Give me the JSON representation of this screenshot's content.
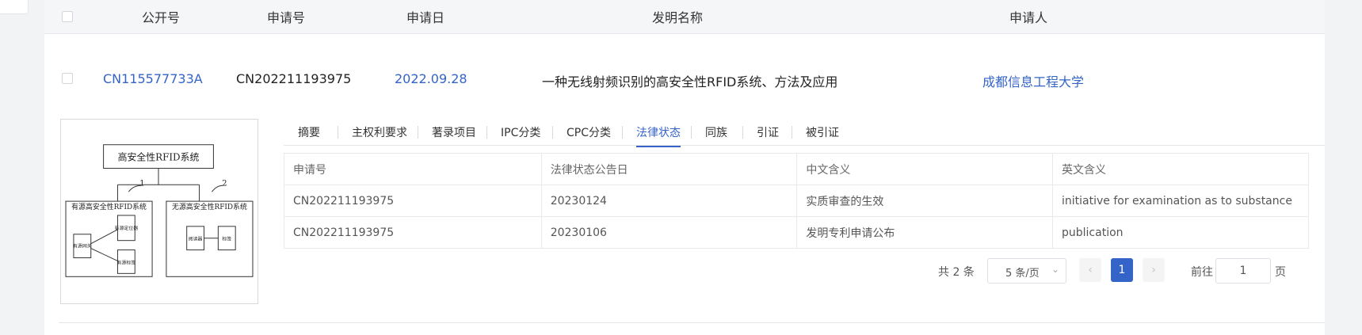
{
  "columns": [
    "公开号",
    "申请号",
    "申请日",
    "发明名称",
    "申请人"
  ],
  "record": {
    "pub_no": "CN115577733A",
    "app_no": "CN202211193975",
    "app_date": "2022.09.28",
    "title": "一种无线射频识别的高安全性RFID系统、方法及应用",
    "applicant": "成都信息工程大学"
  },
  "figure": {
    "top_box": "高安全性RFID系统",
    "left_group": "有源高安全性RFID系统",
    "right_group": "无源高安全性RFID系统",
    "label1": "1",
    "label2": "2",
    "left_node_a": "有源定位器",
    "left_node_b": "有源标签",
    "left_node_c": "有源网关",
    "right_node_a": "阅读器",
    "right_node_b": "标签"
  },
  "tabs": [
    "摘要",
    "主权利要求",
    "著录项目",
    "IPC分类",
    "CPC分类",
    "法律状态",
    "同族",
    "引证",
    "被引证"
  ],
  "active_tab": "法律状态",
  "legal_table": {
    "headers": [
      "申请号",
      "法律状态公告日",
      "中文含义",
      "英文含义"
    ],
    "rows": [
      [
        "CN202211193975",
        "20230124",
        "实质审查的生效",
        "initiative for examination as to substance"
      ],
      [
        "CN202211193975",
        "20230106",
        "发明专利申请公布",
        "publication"
      ]
    ]
  },
  "pagination": {
    "total": "共 2 条",
    "page_size": "5 条/页",
    "prev": "‹",
    "current": "1",
    "next": "›",
    "goto_label": "前往",
    "goto_value": "1",
    "page_suffix": "页"
  },
  "colors": {
    "accent": "#3464c8"
  }
}
